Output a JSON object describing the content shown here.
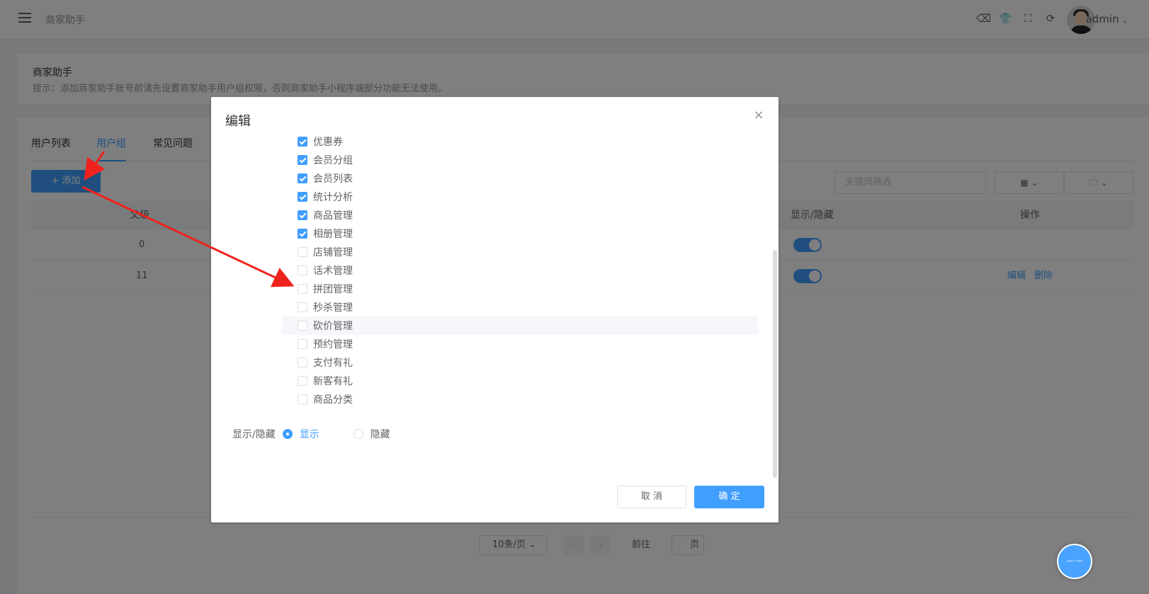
{
  "topbar": {
    "app_title": "商家助手",
    "username": "admin",
    "icons": [
      "clean-icon",
      "skin-icon",
      "fullscreen-icon",
      "refresh-icon"
    ]
  },
  "info": {
    "title": "商家助手",
    "tip": "提示：添加商家助手账号前请先设置商家助手用户组权限，否则商家助手小程序端部分功能无法使用。"
  },
  "tabs": [
    "用户列表",
    "用户组",
    "常见问题"
  ],
  "toolbar": {
    "add_label": "+ 添加",
    "search_placeholder": "关键词筛选"
  },
  "table": {
    "headers": {
      "parent": "父级",
      "visible": "显示/隐藏",
      "actions": "操作"
    },
    "rows": [
      {
        "parent": "0",
        "visible": true
      },
      {
        "parent": "11",
        "visible": true,
        "edit": "编辑",
        "delete": "删除"
      }
    ]
  },
  "pager": {
    "page_size": "10条/页",
    "goto_prefix": "前往",
    "goto_suffix": "页"
  },
  "dialog": {
    "title": "编辑",
    "permissions": [
      {
        "label": "优惠券",
        "checked": true
      },
      {
        "label": "会员分组",
        "checked": true
      },
      {
        "label": "会员列表",
        "checked": true
      },
      {
        "label": "统计分析",
        "checked": true
      },
      {
        "label": "商品管理",
        "checked": true
      },
      {
        "label": "相册管理",
        "checked": true
      },
      {
        "label": "店铺管理",
        "checked": false
      },
      {
        "label": "话术管理",
        "checked": false
      },
      {
        "label": "拼团管理",
        "checked": false
      },
      {
        "label": "秒杀管理",
        "checked": false
      },
      {
        "label": "砍价管理",
        "checked": false
      },
      {
        "label": "预约管理",
        "checked": false
      },
      {
        "label": "支付有礼",
        "checked": false
      },
      {
        "label": "新客有礼",
        "checked": false
      },
      {
        "label": "商品分类",
        "checked": false
      }
    ],
    "visibility_label": "显示/隐藏",
    "show_label": "显示",
    "hide_label": "隐藏",
    "selected": "显示",
    "cancel_label": "取 消",
    "ok_label": "确 定"
  },
  "colors": {
    "primary": "#409eff",
    "arrow": "#f0221d"
  }
}
